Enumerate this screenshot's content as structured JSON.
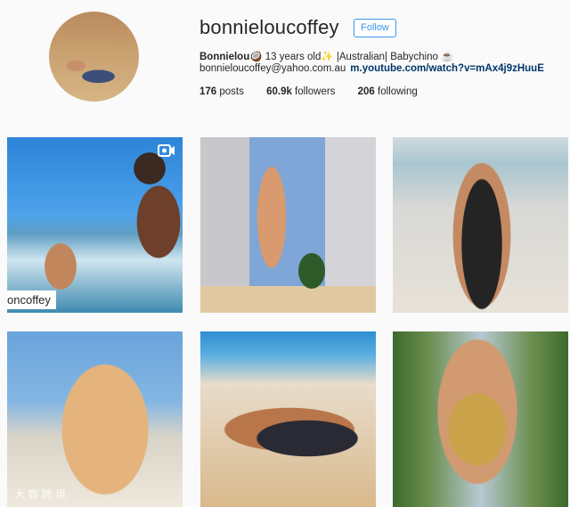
{
  "profile": {
    "username": "bonnieloucoffey",
    "follow_label": "Follow",
    "bio_name": "Bonnielou",
    "bio_text": "🥥 13 years old✨ |Australian| Babychino ☕",
    "email": "bonnieloucoffey@yahoo.com.au",
    "link": "m.youtube.com/watch?v=mAx4j9zHuuE"
  },
  "stats": [
    {
      "value": "176",
      "label": " posts"
    },
    {
      "value": "60.9k",
      "label": " followers"
    },
    {
      "value": "206",
      "label": " following"
    }
  ],
  "grid": {
    "tile1_badge": "oncoffey",
    "watermark": "大 数 跨 境"
  },
  "colors": {
    "follow_accent": "#3897f0",
    "link": "#003569"
  }
}
